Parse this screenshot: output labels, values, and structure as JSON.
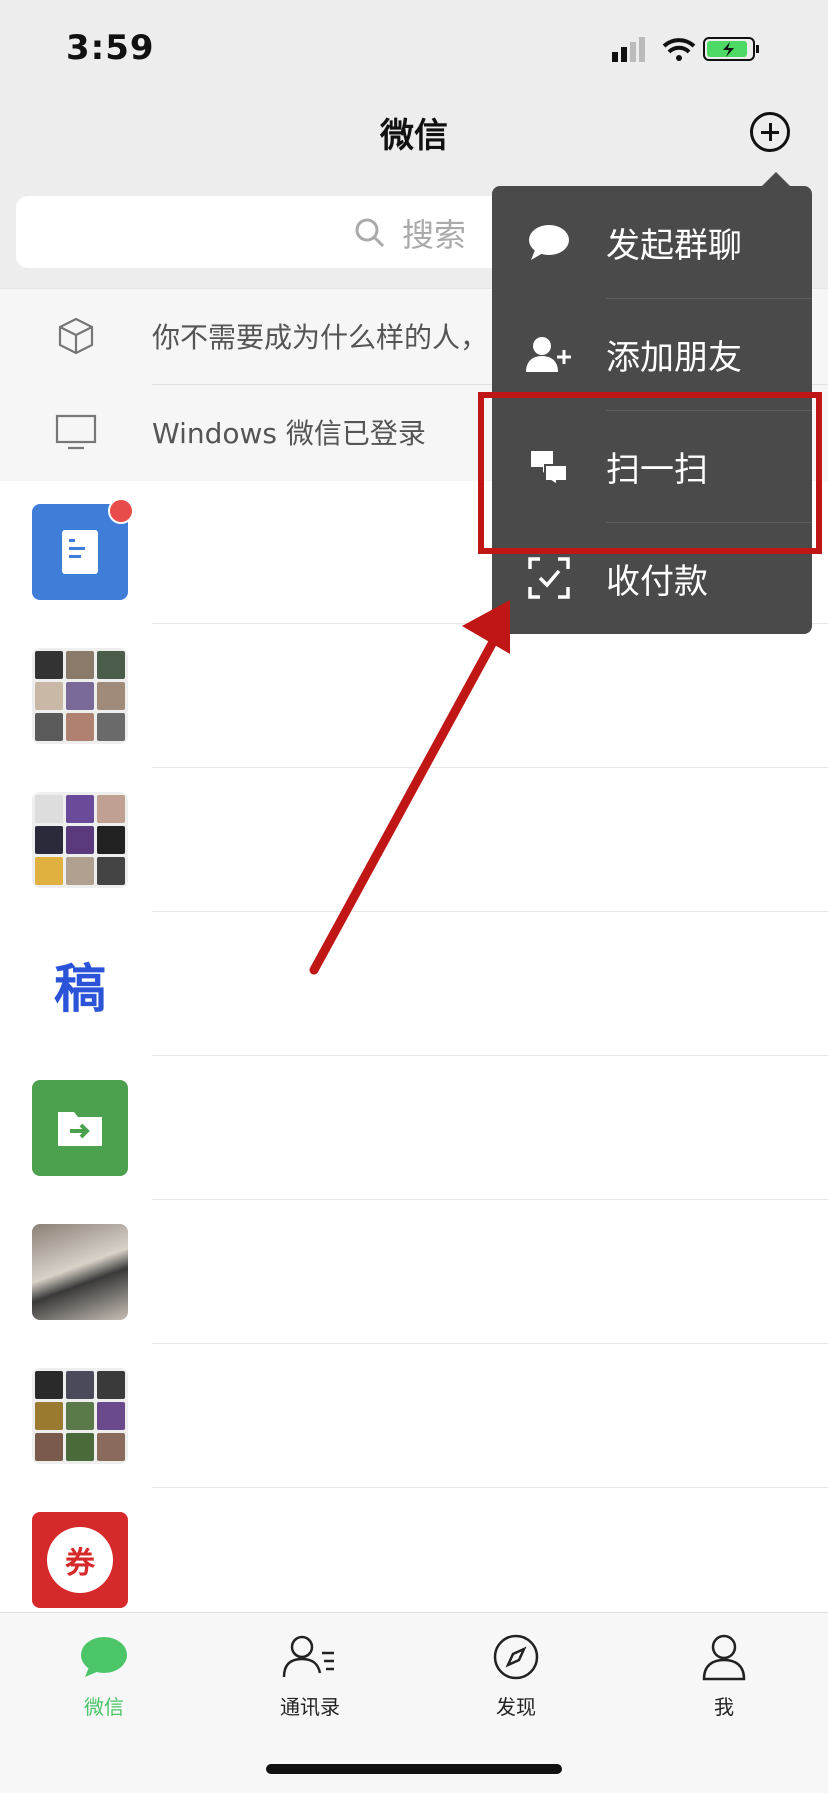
{
  "status_bar": {
    "time": "3:59"
  },
  "header": {
    "title": "微信"
  },
  "search": {
    "placeholder": "搜索"
  },
  "info_rows": [
    {
      "icon": "cube-icon",
      "text": "你不需要成为什么样的人，"
    },
    {
      "icon": "monitor-icon",
      "text": "Windows 微信已登录"
    }
  ],
  "chat_list": {
    "avatars": [
      {
        "name": "file-doc-avatar",
        "color": "#3e7ed9",
        "unread_dot": true
      },
      {
        "name": "group-avatar-1"
      },
      {
        "name": "group-avatar-2"
      },
      {
        "name": "gao-avatar",
        "glyph": "稿",
        "color": "#2b54d9"
      },
      {
        "name": "file-transfer-avatar",
        "color": "#4ca14f"
      },
      {
        "name": "dog-photo-avatar"
      },
      {
        "name": "group-avatar-3"
      },
      {
        "name": "coupon-avatar",
        "glyph": "券",
        "color": "#d62a2a"
      }
    ]
  },
  "menu": {
    "items": [
      {
        "label": "发起群聊",
        "icon": "chat-bubble-icon"
      },
      {
        "label": "添加朋友",
        "icon": "add-friend-icon"
      },
      {
        "label": "扫一扫",
        "icon": "scan-icon"
      },
      {
        "label": "收付款",
        "icon": "payment-icon"
      }
    ]
  },
  "tabs": [
    {
      "label": "微信",
      "icon": "chats-icon",
      "active": true
    },
    {
      "label": "通讯录",
      "icon": "contacts-icon",
      "active": false
    },
    {
      "label": "发现",
      "icon": "discover-icon",
      "active": false
    },
    {
      "label": "我",
      "icon": "me-icon",
      "active": false
    }
  ],
  "colors": {
    "accent": "#4cc569",
    "menu_bg": "#4a4a4a",
    "annotation": "#c01616"
  }
}
